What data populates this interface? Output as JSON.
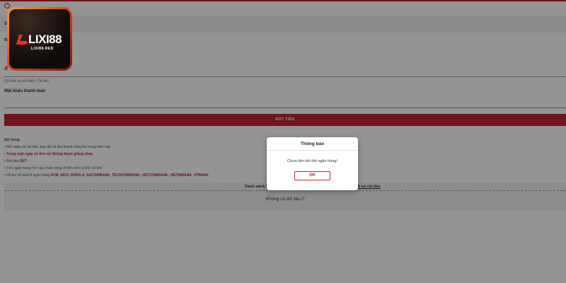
{
  "brand": {
    "logo_text": "LIXI88",
    "logo_sub": "LIXI88.RED"
  },
  "form": {
    "header_letter": "S",
    "name_letter": "N",
    "limit_note": "(Số tiền rút tối thiểu / Tối đa )",
    "password_label": "Mật khẩu thanh toán",
    "withdraw_button": "RÚT TIỀN"
  },
  "notes": {
    "title": "Nội dung",
    "items": [
      {
        "text": "Mỗi ngày chỉ rút tiền, bạn đã rút tiền thành công lần trong hôm nay"
      },
      {
        "text": "Trong một ngày số tiền rút không được giống nhau"
      },
      {
        "prefix": "Rút tiền ",
        "highlight": "24/7"
      },
      {
        "text": "Tên ngân hàng mới các nhân riêng chỉ lên mới có thể rút tiền"
      },
      {
        "prefix": "Hỗ trợ tối nhất 8 ngân hàng ",
        "highlight": "ACB, BIDV, DONG A, SACOMBANK, TECHCOMBANK, VIETCOMBANK, VIETINBANK, VPBANK"
      }
    ]
  },
  "history": {
    "tab_left": "Danh sách S",
    "tab_right": "ịch sử rút tiền",
    "empty_text": "Không có dữ liệu !!"
  },
  "modal": {
    "title": "Thông báo",
    "message": "Chưa liên kết thẻ ngân hàng!",
    "ok_label": "OK"
  },
  "colors": {
    "accent": "#c0272d",
    "overlay": "rgba(0,0,0,0.42)"
  }
}
